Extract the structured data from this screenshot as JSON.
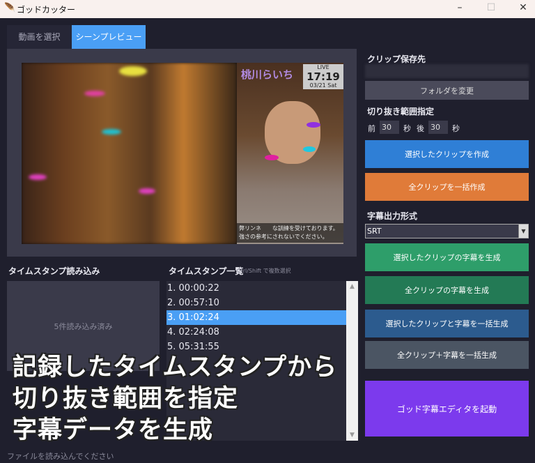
{
  "window": {
    "title": "ゴッドカッター",
    "icon": "feather-icon",
    "minimize": "–",
    "maximize": "☐",
    "close": "✕"
  },
  "tabs": [
    {
      "label": "動画を選択",
      "active": false
    },
    {
      "label": "シーンプレビュー",
      "active": true
    }
  ],
  "preview": {
    "logo": "桃川らいち",
    "live_badge": "LIVE",
    "clock": "17:19",
    "date": "03/21 Sat",
    "subtitle_line1": "弊リンネ　　な訓練を受けております。",
    "subtitle_line2": "強さの参考にされないでください。"
  },
  "right": {
    "save_label": "クリップ保存先",
    "folder_button": "フォルダを変更",
    "range_label": "切り抜き範囲指定",
    "before_label": "前",
    "before_value": "30",
    "sec1": "秒",
    "after_label": "後",
    "after_value": "30",
    "sec2": "秒",
    "create_selected": "選択したクリップを作成",
    "create_all": "全クリップを一括作成",
    "subtitle_format_label": "字幕出力形式",
    "subtitle_format": "SRT",
    "sub_selected": "選択したクリップの字幕を生成",
    "sub_all": "全クリップの字幕を生成",
    "clip_sub_selected": "選択したクリップと字幕を一括生成",
    "clip_sub_all": "全クリップ＋字幕を一括生成",
    "launch_editor": "ゴッド字幕エディタを起動"
  },
  "colors": {
    "accent": "#4a9ff5",
    "create_selected": "#2f7fd6",
    "create_all": "#e07b39",
    "sub_selected": "#2e9e6a",
    "sub_all": "#237a55",
    "clip_sub_selected": "#2c5b8e",
    "clip_sub_all": "#4b5563",
    "launch_editor": "#7c3aed"
  },
  "import": {
    "label": "タイムスタンプ読み込み",
    "status": "5件読み込み済み"
  },
  "timestamps": {
    "label": "タイムスタンプ一覧",
    "hint": "Ctrl/Shift で複数選択",
    "items": [
      "1. 00:00:22",
      "2. 00:57:10",
      "3. 01:02:24",
      "4. 02:24:08",
      "5. 05:31:55"
    ],
    "selected_index": 2
  },
  "overlay": {
    "line1": "記録したタイムスタンプから",
    "line2": "切り抜き範囲を指定",
    "line3": "字幕データを生成"
  },
  "status_bar": "ファイルを読み込んでください"
}
